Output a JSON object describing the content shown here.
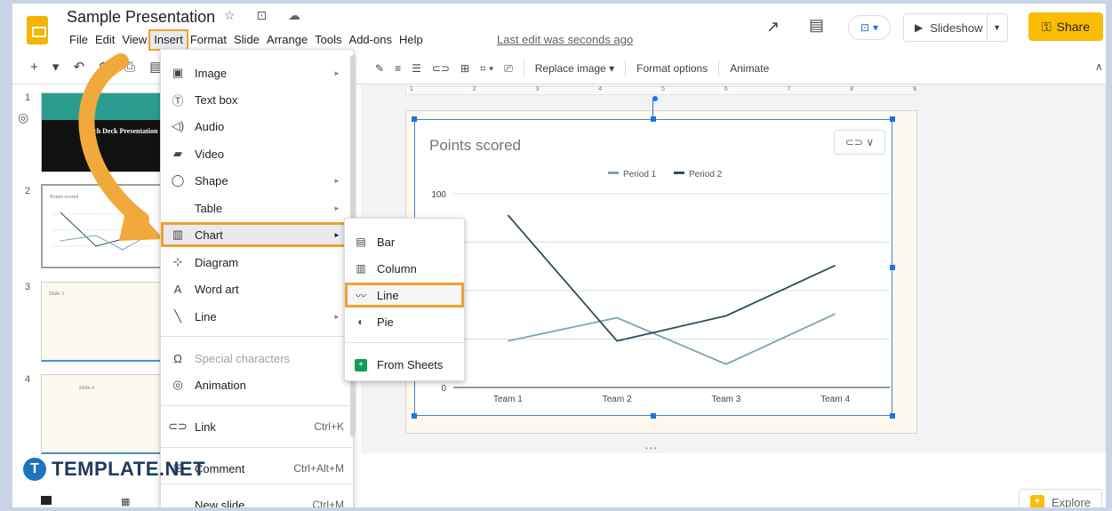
{
  "app": {
    "title": "Sample Presentation",
    "title_icons": "☆ ⊡ ☁",
    "menu": [
      "File",
      "Edit",
      "View",
      "Insert",
      "Format",
      "Slide",
      "Arrange",
      "Tools",
      "Add-ons",
      "Help"
    ],
    "active_menu": "Insert",
    "last_edit": "Last edit was seconds ago",
    "slideshow_label": "Slideshow",
    "share_label": "Share",
    "brand_color": "#fbbc04"
  },
  "toolbar": {
    "left_glyphs": "+ ▾ ↶ ↷ ⎙ ▤",
    "replace_image": "Replace image ▾",
    "format_options": "Format options",
    "animate": "Animate"
  },
  "filmstrip": {
    "slides": [
      {
        "num": "1",
        "label": "Tech Deck Presentation"
      },
      {
        "num": "2",
        "label": "Points scored"
      },
      {
        "num": "3",
        "label": "Slide 3"
      },
      {
        "num": "4",
        "label": "Slide 4"
      }
    ]
  },
  "insert_menu": {
    "items": [
      {
        "icon": "▣",
        "label": "Image",
        "arrow": "►",
        "shortcut": ""
      },
      {
        "icon": "Ⓣ",
        "label": "Text box",
        "arrow": "",
        "shortcut": ""
      },
      {
        "icon": "◁)",
        "label": "Audio",
        "arrow": "",
        "shortcut": ""
      },
      {
        "icon": "▰",
        "label": "Video",
        "arrow": "",
        "shortcut": ""
      },
      {
        "icon": "◯",
        "label": "Shape",
        "arrow": "►",
        "shortcut": ""
      },
      {
        "icon": "",
        "label": "Table",
        "arrow": "►",
        "shortcut": ""
      },
      {
        "icon": "▥",
        "label": "Chart",
        "arrow": "►",
        "shortcut": ""
      },
      {
        "icon": "⊹",
        "label": "Diagram",
        "arrow": "",
        "shortcut": ""
      },
      {
        "icon": "A",
        "label": "Word art",
        "arrow": "",
        "shortcut": ""
      },
      {
        "icon": "╲",
        "label": "Line",
        "arrow": "►",
        "shortcut": ""
      },
      {
        "icon": "Ω",
        "label": "Special characters",
        "arrow": "",
        "shortcut": ""
      },
      {
        "icon": "◎",
        "label": "Animation",
        "arrow": "",
        "shortcut": ""
      },
      {
        "icon": "⊂⊃",
        "label": "Link",
        "arrow": "",
        "shortcut": "Ctrl+K"
      },
      {
        "icon": "⊞",
        "label": "Comment",
        "arrow": "",
        "shortcut": "Ctrl+Alt+M"
      },
      {
        "icon": "",
        "label": "New slide",
        "arrow": "",
        "shortcut": "Ctrl+M"
      }
    ],
    "highlighted": "Chart"
  },
  "chart_submenu": {
    "items": [
      {
        "icon": "▤",
        "label": "Bar"
      },
      {
        "icon": "▥",
        "label": "Column"
      },
      {
        "icon": "〰",
        "label": "Line"
      },
      {
        "icon": "◐",
        "label": "Pie"
      },
      {
        "icon": "+",
        "label": "From Sheets"
      }
    ],
    "highlighted": "Line"
  },
  "chart_data": {
    "type": "line",
    "title": "Points scored",
    "categories": [
      "Team 1",
      "Team 2",
      "Team 3",
      "Team 4"
    ],
    "series": [
      {
        "name": "Period 1",
        "values": [
          24,
          36,
          12,
          38
        ],
        "color": "#7ba3b5"
      },
      {
        "name": "Period 2",
        "values": [
          89,
          24,
          37,
          63
        ],
        "color": "#2e4d5c"
      }
    ],
    "ylim": [
      0,
      100
    ],
    "yticks": [
      "100",
      "0"
    ],
    "legend": "top"
  },
  "chart_link_icons": "⊂⊃ ∨",
  "watermark": {
    "badge": "T",
    "text": "TEMPLATE.NET"
  },
  "explore": {
    "label": "Explore"
  }
}
